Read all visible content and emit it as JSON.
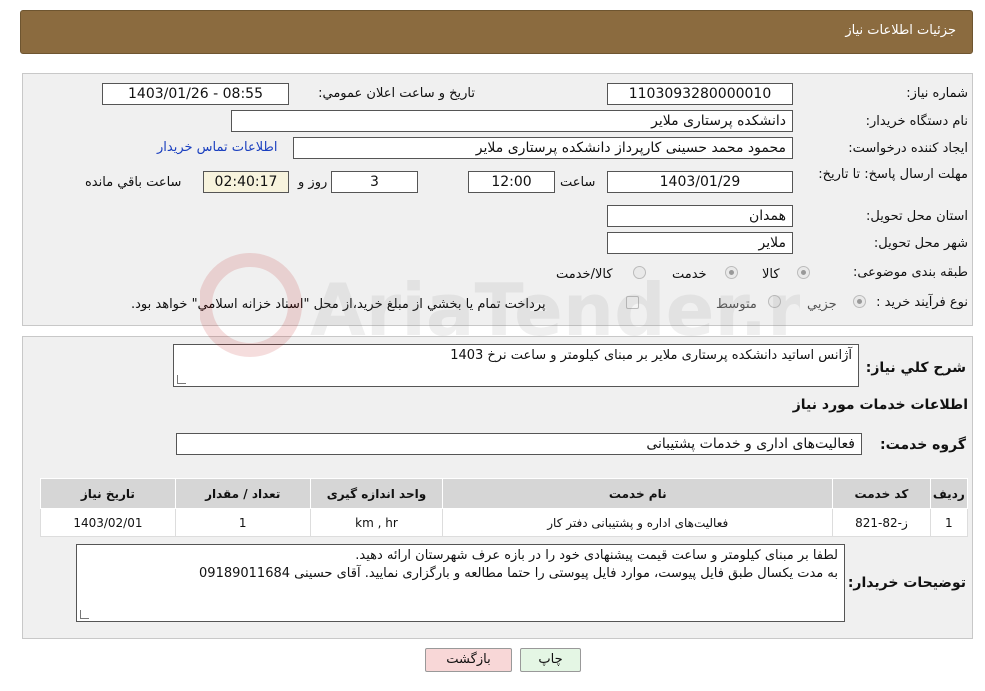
{
  "header": {
    "title": "جزئیات اطلاعات نیاز"
  },
  "form": {
    "need_number_label": "شماره نیاز:",
    "need_number": "1103093280000010",
    "announce_label": "تاریخ و ساعت اعلان عمومي:",
    "announce_value": "1403/01/26 - 08:55",
    "buyer_org_label": "نام دستگاه خريدار:",
    "buyer_org": "دانشکده پرستاری ملایر",
    "creator_label": "ايجاد کننده درخواست:",
    "creator": "محمود محمد حسینی کارپرداز دانشکده پرستاری ملایر",
    "contact_link": "اطلاعات تماس خريدار",
    "deadline_label": "مهلت ارسال پاسخ: تا تاریخ:",
    "deadline_date": "1403/01/29",
    "time_label": "ساعت",
    "deadline_time": "12:00",
    "days_value": "3",
    "days_label": "روز و",
    "remaining_time": "02:40:17",
    "remaining_label": "ساعت باقي مانده",
    "province_label": "استان محل تحويل:",
    "province": "همدان",
    "city_label": "شهر محل تحويل:",
    "city": "ملاير",
    "category_label": "طبقه بندی موضوعی:",
    "category_options": [
      "کالا",
      "خدمت",
      "کالا/خدمت"
    ],
    "process_label": "نوع فرآيند خريد :",
    "process_options": [
      "جزيي",
      "متوسط"
    ],
    "payment_note": "پرداخت تمام يا بخشي از مبلغ خريد،از محل \"اسناد خزانه اسلامي\" خواهد بود."
  },
  "summary": {
    "label": "شرح کلي نياز:",
    "value": "آژانس اساتید دانشکده پرستاری ملایر بر مبنای کیلومتر و ساعت نرخ 1403"
  },
  "services": {
    "section_title": "اطلاعات خدمات مورد نياز",
    "group_label": "گروه خدمت:",
    "group_value": "فعاليت‌های اداری و خدمات پشتيبانی",
    "columns": [
      "رديف",
      "کد خدمت",
      "نام خدمت",
      "واحد اندازه گيری",
      "تعداد / مقدار",
      "تاريخ نياز"
    ],
    "rows": [
      [
        "1",
        "ز-82-821",
        "فعالیت‌های اداره و پشتیبانی دفتر کار",
        "km , hr",
        "1",
        "1403/02/01"
      ]
    ]
  },
  "buyer_notes": {
    "label": "توضيحات خريدار:",
    "line1": "لطفا بر مبنای کیلومتر و ساعت قیمت پیشنهادی خود را در بازه عرف شهرستان ارائه دهید.",
    "line2": "به مدت یکسال طبق فایل پیوست، موارد فایل پیوستی را حتما مطالعه و بارگزاری نمایید. آقای حسینی   09189011684"
  },
  "buttons": {
    "print": "چاپ",
    "back": "بازگشت"
  },
  "watermark_text": "AriaTender.neT",
  "colors": {
    "header": "#8b6b3f",
    "link": "#1a3fbf",
    "back_button": "#f8d7d7",
    "print_button": "#e4f6e4"
  }
}
